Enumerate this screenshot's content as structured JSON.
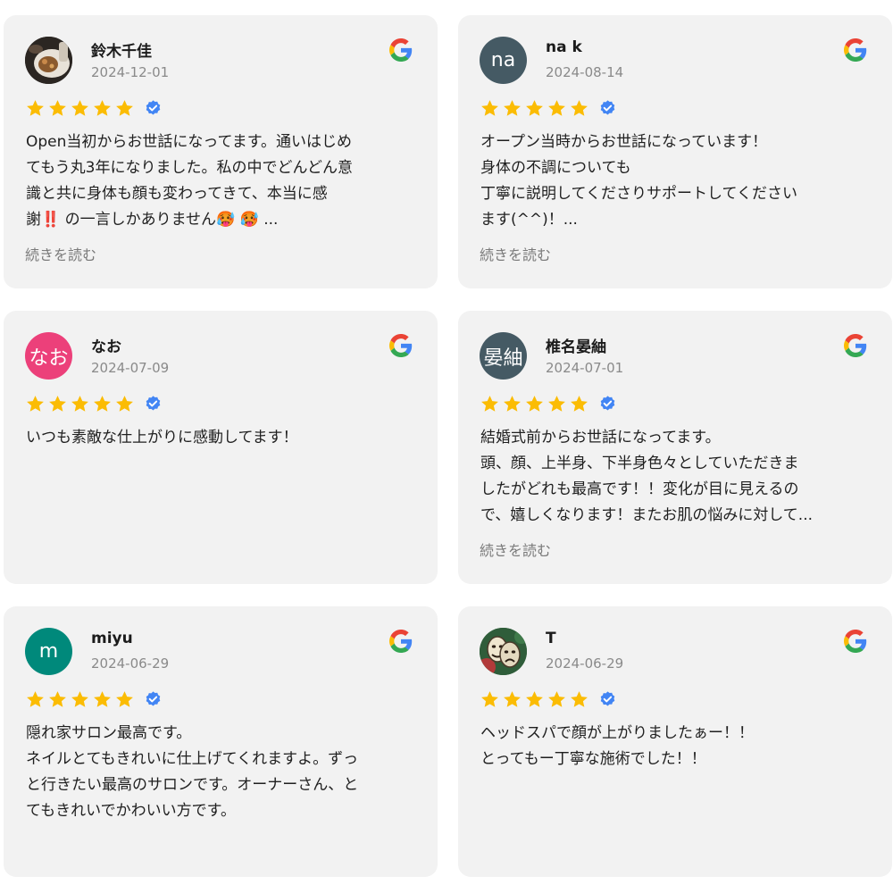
{
  "colors": {
    "card_bg": "#f2f2f2",
    "star": "#fbbc04",
    "verified": "#4285f4",
    "google_blue": "#4285f4",
    "google_red": "#ea4335",
    "google_yellow": "#fbbc05",
    "google_green": "#34a853"
  },
  "reviews": [
    {
      "name": "鈴木千佳",
      "date": "2024-12-01",
      "avatar_type": "photo-food",
      "avatar_text": "",
      "avatar_color": "#3a3a3a",
      "rating": 5,
      "text": "Open当初からお世話になってます。通いはじめ\nてもう丸3年になりました。私の中でどんどん意\n識と共に身体も顔も変わってきて、本当に感\n謝‼️ の一言しかありません🥵 🥵 ...",
      "read_more": "続きを読む"
    },
    {
      "name": "na k",
      "date": "2024-08-14",
      "avatar_type": "letters",
      "avatar_text": "na",
      "avatar_color": "#455a64",
      "rating": 5,
      "text": "オープン当時からお世話になっています！\n身体の不調についても\n丁寧に説明してくださりサポートしてください\nます(^^)！...",
      "read_more": "続きを読む"
    },
    {
      "name": "なお",
      "date": "2024-07-09",
      "avatar_type": "letters",
      "avatar_text": "なお",
      "avatar_color": "#ec407a",
      "rating": 5,
      "text": "いつも素敵な仕上がりに感動してます！",
      "read_more": ""
    },
    {
      "name": "椎名晏紬",
      "date": "2024-07-01",
      "avatar_type": "letters",
      "avatar_text": "晏紬",
      "avatar_color": "#455a64",
      "rating": 5,
      "text": "結婚式前からお世話になってます。\n頭、顔、上半身、下半身色々としていただきま\nしたがどれも最高です！！変化が目に見えるの\nで、嬉しくなります！またお肌の悩みに対して...",
      "read_more": "続きを読む"
    },
    {
      "name": "miyu",
      "date": "2024-06-29",
      "avatar_type": "letters",
      "avatar_text": "m",
      "avatar_color": "#00897b",
      "rating": 5,
      "text": "隠れ家サロン最高です。\nネイルとてもきれいに仕上げてくれますよ。ずっ\nと行きたい最高のサロンです。オーナーさん、と\nてもきれいでかわいい方です。",
      "read_more": ""
    },
    {
      "name": "T",
      "date": "2024-06-29",
      "avatar_type": "photo-masks",
      "avatar_text": "",
      "avatar_color": "#2f5d3a",
      "rating": 5,
      "text": "ヘッドスパで顔が上がりましたぁー！！\nとってもー丁寧な施術でした！！",
      "read_more": ""
    }
  ]
}
